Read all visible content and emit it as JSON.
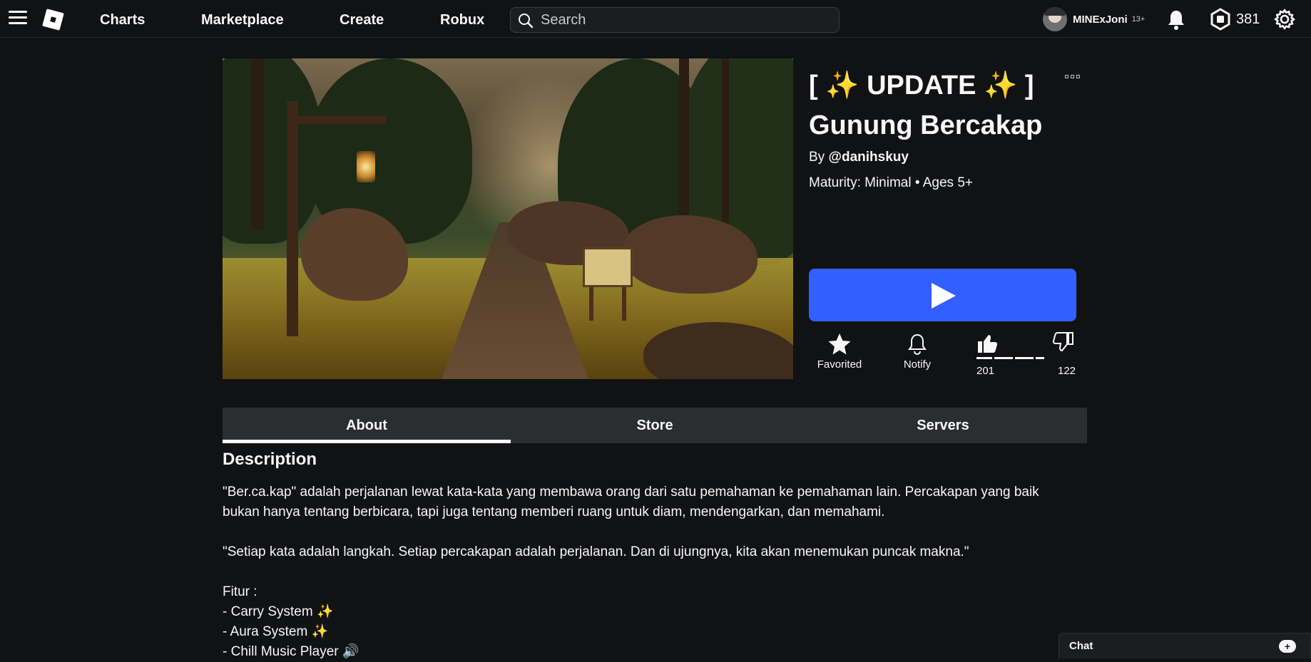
{
  "nav": {
    "links": [
      "Charts",
      "Marketplace",
      "Create",
      "Robux"
    ],
    "search_placeholder": "Search",
    "username": "MINExJoni",
    "age_badge": "13+",
    "robux_balance": "381"
  },
  "experience": {
    "title": "[ ✨ UPDATE ✨ ] Gunung Bercakap",
    "by_prefix": "By ",
    "creator": "@danihskuy",
    "maturity": "Maturity: Minimal • Ages 5+"
  },
  "actions": {
    "favorite_label": "Favorited",
    "notify_label": "Notify",
    "upvotes": "201",
    "downvotes": "122",
    "like_ratio": 0.62
  },
  "tabs": [
    "About",
    "Store",
    "Servers"
  ],
  "active_tab": "About",
  "description": {
    "heading": "Description",
    "lines": [
      "\"Ber.ca.kap\" adalah perjalanan lewat kata-kata yang membawa orang dari satu pemahaman ke pemahaman lain. Percakapan yang baik bukan hanya tentang berbicara, tapi juga tentang memberi ruang untuk diam, mendengarkan, dan memahami.",
      "\"Setiap kata adalah langkah. Setiap percakapan adalah perjalanan. Dan di ujungnya, kita akan menemukan puncak makna.\"",
      "Fitur :",
      "- Carry System ✨",
      "- Aura System ✨",
      "- Chill Music Player 🔊"
    ]
  },
  "chat": {
    "label": "Chat"
  },
  "colors": {
    "accent": "#335fff",
    "background": "#111214",
    "tab_bg": "#2b2d31"
  }
}
